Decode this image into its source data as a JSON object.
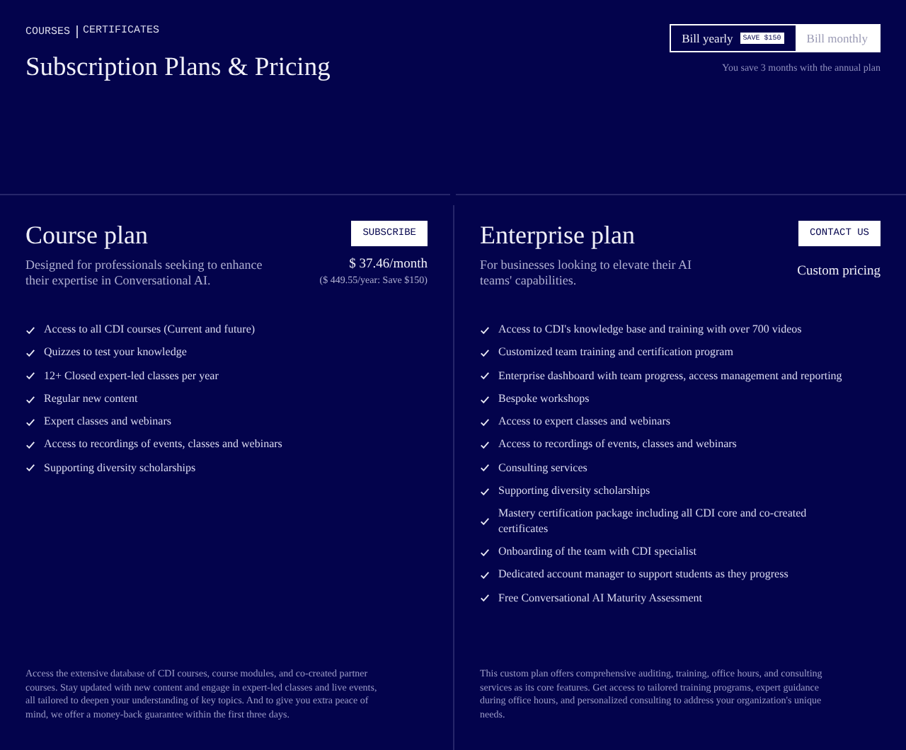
{
  "breadcrumb": [
    "COURSES",
    "CERTIFICATES"
  ],
  "title": "Subscription Plans & Pricing",
  "billing_toggle": {
    "options": [
      {
        "label": "Bill yearly",
        "badge": "SAVE $150",
        "selected": true
      },
      {
        "label": "Bill monthly",
        "selected": false
      }
    ],
    "note": "You save 3 months with the annual plan"
  },
  "plans": [
    {
      "name": "Course plan",
      "button": "SUBSCRIBE",
      "description": "Designed for professionals seeking to enhance their expertise in Conversational AI.",
      "price": "$ 37.46/month",
      "price_note": "($ 449.55/year: Save $150)",
      "features": [
        "Access to all CDI courses (Current and future)",
        "Quizzes to test your knowledge",
        "12+ Closed expert-led classes per year",
        "Regular new content",
        "Expert classes and webinars",
        "Access to recordings of events, classes and webinars",
        "Supporting diversity scholarships"
      ],
      "footnote": "Access the extensive database of CDI courses, course modules, and co-created partner courses. Stay updated with new content and engage in expert-led classes and live events, all tailored to deepen your understanding of key topics. And to give you extra peace of mind, we offer a money-back guarantee within the first three days."
    },
    {
      "name": "Enterprise plan",
      "button": "CONTACT US",
      "description": "For businesses looking to elevate their AI teams' capabilities.",
      "price": "Custom pricing",
      "features": [
        "Access to CDI's knowledge base and training with over 700 videos",
        "Customized team training and certification program",
        "Enterprise dashboard with team progress, access management and reporting",
        "Bespoke workshops",
        "Access to expert classes and webinars",
        "Access to recordings of events, classes and webinars",
        "Consulting services",
        "Supporting diversity scholarships",
        "Mastery certification package including all CDI core and co-created certificates",
        "Onboarding of the team with CDI specialist",
        "Dedicated account manager to support students as they progress",
        "Free Conversational AI Maturity Assessment"
      ],
      "footnote": "This custom plan offers comprehensive auditing, training, office hours, and consulting services as its core features. Get access to tailored training programs, expert guidance during office hours, and personalized consulting to address your organization's unique needs."
    }
  ]
}
